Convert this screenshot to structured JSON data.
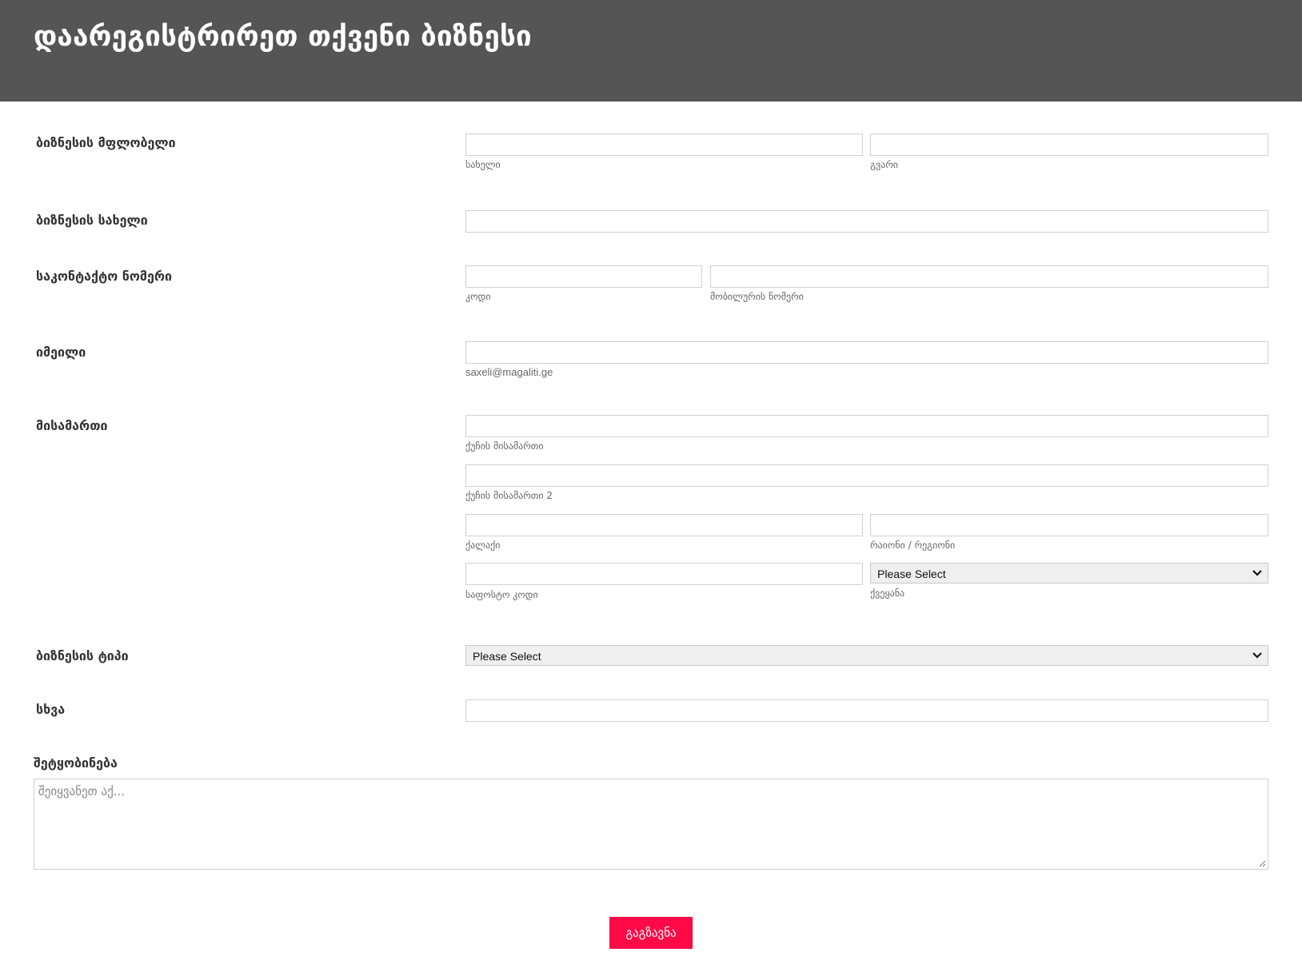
{
  "header": {
    "title": "დაარეგისტრირეთ თქვენი ბიზნესი"
  },
  "owner": {
    "label": "ბიზნესის მფლობელი",
    "first_sub": "სახელი",
    "last_sub": "გვარი"
  },
  "business_name": {
    "label": "ბიზნესის სახელი"
  },
  "contact": {
    "label": "საკონტაქტო ნომერი",
    "code_sub": "კოდი",
    "mobile_sub": "მობილურის ნომერი"
  },
  "email": {
    "label": "იმეილი",
    "sub": "saxeli@magaliti.ge"
  },
  "address": {
    "label": "მისამართი",
    "street_sub": "ქუჩის მისამართი",
    "street2_sub": "ქუჩის მისამართი 2",
    "city_sub": "ქალაქი",
    "region_sub": "რაიონი / რეგიონი",
    "postal_sub": "საფოსტო კოდი",
    "country_value": "Please Select",
    "country_sub": "ქვეყანა"
  },
  "business_type": {
    "label": "ბიზნესის ტიპი",
    "value": "Please Select"
  },
  "other": {
    "label": "სხვა"
  },
  "message": {
    "label": "შეტყობინება",
    "placeholder": "შეიყვანეთ აქ..."
  },
  "submit": {
    "label": "გაგზავნა"
  },
  "colors": {
    "header_bg": "#555555",
    "submit_bg": "#ff0a47"
  },
  "icons": {
    "select_arrow": "chevron-down-icon",
    "resize": "resize-grip-icon"
  }
}
